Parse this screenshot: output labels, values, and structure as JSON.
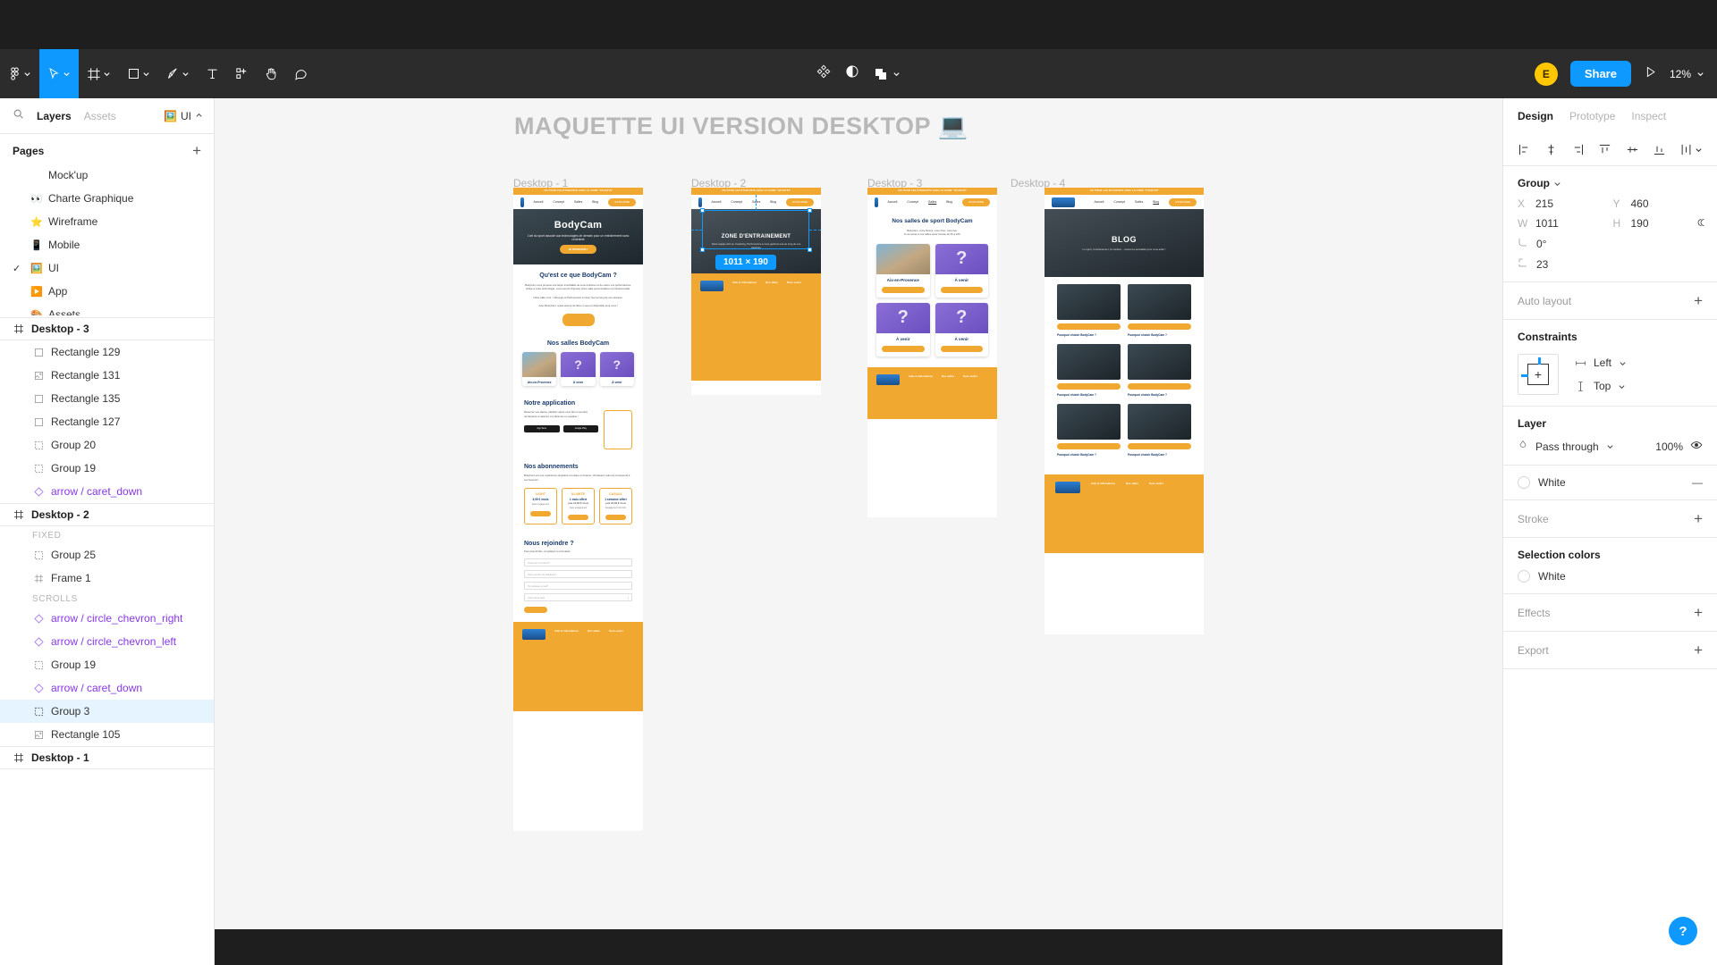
{
  "toolbar": {
    "tools": [
      {
        "name": "figma-menu-icon",
        "label": "Main menu",
        "caret": true,
        "active": false
      },
      {
        "name": "move-tool-icon",
        "label": "Move",
        "caret": true,
        "active": true
      },
      {
        "name": "frame-tool-icon",
        "label": "Frame",
        "caret": true,
        "active": false
      },
      {
        "name": "shape-tool-icon",
        "label": "Rectangle",
        "caret": true,
        "active": false
      },
      {
        "name": "pen-tool-icon",
        "label": "Pen",
        "caret": true,
        "active": false
      },
      {
        "name": "text-tool-icon",
        "label": "Text",
        "caret": false,
        "active": false
      },
      {
        "name": "components-tool-icon",
        "label": "Resources",
        "caret": false,
        "active": false
      },
      {
        "name": "hand-tool-icon",
        "label": "Hand",
        "caret": false,
        "active": false
      },
      {
        "name": "comment-tool-icon",
        "label": "Comment",
        "caret": false,
        "active": false
      }
    ],
    "center_actions": [
      {
        "name": "component-icon",
        "label": "Create component"
      },
      {
        "name": "mask-icon",
        "label": "Use as mask"
      },
      {
        "name": "boolean-icon",
        "label": "Boolean groups",
        "caret": true
      }
    ],
    "avatar_initial": "E",
    "avatar_color": "#ffc700",
    "share_label": "Share",
    "present_label": "Present",
    "zoom_level": "12%",
    "accent_color": "#0d99ff"
  },
  "left_panel": {
    "tabs": [
      {
        "label": "Layers",
        "active": true
      },
      {
        "label": "Assets",
        "active": false
      }
    ],
    "search_icon": "search-icon",
    "file_name": "UI",
    "file_emoji": "🖼️",
    "pages_title": "Pages",
    "add_page_label": "+",
    "pages": [
      {
        "label": "Mock'up",
        "emoji": "",
        "current": false
      },
      {
        "label": "Charte Graphique",
        "emoji": "👀",
        "current": false
      },
      {
        "label": "Wireframe",
        "emoji": "⭐",
        "current": false
      },
      {
        "label": "Mobile",
        "emoji": "📱",
        "current": false
      },
      {
        "label": "UI",
        "emoji": "🖼️",
        "current": true
      },
      {
        "label": "App",
        "emoji": "▶️",
        "current": false
      },
      {
        "label": "Assets",
        "emoji": "🎨",
        "current": false
      }
    ],
    "layer_groups": [
      {
        "frame": "Desktop - 3",
        "sections": [
          {
            "label": "",
            "layers": [
              {
                "label": "Rectangle 129",
                "icon": "rectangle-icon",
                "type": "shape",
                "selected": false
              },
              {
                "label": "Rectangle 131",
                "icon": "image-icon",
                "type": "image",
                "selected": false
              },
              {
                "label": "Rectangle 135",
                "icon": "rectangle-icon",
                "type": "shape",
                "selected": false
              },
              {
                "label": "Rectangle 127",
                "icon": "rectangle-icon",
                "type": "shape",
                "selected": false
              },
              {
                "label": "Group 20",
                "icon": "group-icon",
                "type": "group",
                "selected": false
              },
              {
                "label": "Group 19",
                "icon": "group-icon",
                "type": "group",
                "selected": false
              },
              {
                "label": "arrow / caret_down",
                "icon": "component-icon",
                "type": "component",
                "selected": false
              }
            ]
          }
        ]
      },
      {
        "frame": "Desktop - 2",
        "sections": [
          {
            "label": "FIXED",
            "layers": [
              {
                "label": "Group 25",
                "icon": "group-icon",
                "type": "group",
                "selected": false
              },
              {
                "label": "Frame 1",
                "icon": "frame-icon",
                "type": "frame",
                "selected": false
              }
            ]
          },
          {
            "label": "SCROLLS",
            "layers": [
              {
                "label": "arrow / circle_chevron_right",
                "icon": "component-icon",
                "type": "component",
                "selected": false
              },
              {
                "label": "arrow / circle_chevron_left",
                "icon": "component-icon",
                "type": "component",
                "selected": false
              },
              {
                "label": "Group 19",
                "icon": "group-icon",
                "type": "group",
                "selected": false
              },
              {
                "label": "arrow / caret_down",
                "icon": "component-icon",
                "type": "component",
                "selected": false
              },
              {
                "label": "Group 3",
                "icon": "group-icon",
                "type": "group",
                "selected": true
              },
              {
                "label": "Rectangle 105",
                "icon": "image-icon",
                "type": "image",
                "selected": false
              }
            ]
          }
        ]
      },
      {
        "frame": "Desktop - 1",
        "sections": []
      }
    ]
  },
  "canvas": {
    "title": "MAQUETTE UI VERSION DESKTOP 💻",
    "frames": [
      {
        "label": "Desktop - 1"
      },
      {
        "label": "Desktop - 2"
      },
      {
        "label": "Desktop - 3"
      },
      {
        "label": "Desktop - 4"
      }
    ],
    "selection_badge": "1011 × 190",
    "mock": {
      "promo_banner": "-5% POUR LES ÉTUDIANTS AVEC LE CODE \"STUDY25\"",
      "nav": [
        "Accueil",
        "Concept",
        "Salles",
        "Blog"
      ],
      "nav_cta": "S'INSCRIRE",
      "hero_title": "BodyCam",
      "hero_sub": "L'art du sport associé aux technologies de demain pour un entraînement sans contrainte",
      "hero_btn": "JE M'INSCRIS !",
      "s1_title": "Qu'est ce que BodyCam ?",
      "s1_body": "BodyCam vous propose une façon inoubliable de vous entraîner et de suivre vos performances. Grâce à notre technologie, vous pourrez disposer d'une salle personnalisée et professionnelle.",
      "s1_body2": "Notre salle c'est : L'Énergie et Performance à mixer tout au long de vos séances.",
      "s1_body3": "Avec BodyCam, repas assuré de faire un quoi et disponible pour vous !",
      "s2_title": "Nos salles BodyCam",
      "s2_sub": "BodyCam, votre fitness, votre futur, votre lieu.\nTu as accès à nos salles toute l'année de 6h à 23h.",
      "s3_title": "Nos salles de sport BodyCam",
      "s4_title": "Notre application",
      "s4_body": "Réservez vos places, planifiez après vous fait un sportive remarquent et assurez vos abonnés en quelque !",
      "store_badges": [
        "App Store",
        "Google Play"
      ],
      "s5_title": "Nos abonnements",
      "s5_body": "BodyCam est une expérience singulière et unique en France. Choisissez celui qui correspond à vos besoins !",
      "plans": [
        {
          "name": "LIGHT",
          "price": "9,99 € /mois",
          "note": "Sans engagement",
          "cta": "JE M'INSCRIS"
        },
        {
          "name": "ILLIMITÉ",
          "price": "1 mois offert",
          "price2": "puis 24,99 € /mois",
          "note": "Sans engagement",
          "cta": "JE M'INSCRIS"
        },
        {
          "name": "CASUAL",
          "price": "1 semaine offert",
          "price2": "puis 29,99 € /mois",
          "note": "Engagement 12 mois",
          "cta": "JE M'INSCRIS"
        }
      ],
      "s6_title": "Nous rejoindre ?",
      "s6_sub": "Pour plus d'infos, complétez ce formulaire",
      "form_fields": [
        "Votre nom et prénom*",
        "Votre numéro de téléphone*",
        "Ton adresse e-mail*"
      ],
      "form_select": "Choix de la suite",
      "form_cta": "ENVOYER",
      "footer_cols": [
        "Aide et informations",
        "Nos salles",
        "Nous suivre"
      ],
      "gym_cards": [
        {
          "title": "Aix-en-Provence",
          "type": "photo",
          "cta": "Voir sur la carte"
        },
        {
          "title": "À venir",
          "type": "placeholder",
          "cta": "Voir sur la carte"
        },
        {
          "title": "À venir",
          "type": "placeholder",
          "cta": "Voir sur la carte"
        },
        {
          "title": "À venir",
          "type": "placeholder",
          "cta": "Voir sur la carte"
        }
      ],
      "zone_title": "ZONE D'ENTRAINEMENT",
      "zone_sub": "Notre équipe d'ici en Coaching, Performance à vous guidons tout au long de vos séances",
      "blog_title": "BLOG",
      "blog_sub": "Le sport, l'entrainement, la nutrition... toutes les actualités pour vous aider !",
      "blog_card_title": "Pourquoi choisir BodyCam ?"
    }
  },
  "right_panel": {
    "tabs": [
      {
        "label": "Design",
        "active": true
      },
      {
        "label": "Prototype",
        "active": false
      },
      {
        "label": "Inspect",
        "active": false
      }
    ],
    "align_icons": [
      "align-left-icon",
      "align-horizontal-center-icon",
      "align-right-icon",
      "align-top-icon",
      "align-vertical-center-icon",
      "align-bottom-icon",
      "distribute-icon"
    ],
    "selection_type": "Group",
    "position": {
      "x_label": "X",
      "x_value": "215",
      "y_label": "Y",
      "y_value": "460",
      "w_label": "W",
      "w_value": "1011",
      "h_label": "H",
      "h_value": "190",
      "rotation": "0°",
      "corner_radius": "23"
    },
    "auto_layout": {
      "label": "Auto layout",
      "add": "+"
    },
    "constraints": {
      "title": "Constraints",
      "horizontal": "Left",
      "vertical": "Top"
    },
    "layer": {
      "title": "Layer",
      "blend_mode": "Pass through",
      "opacity": "100%",
      "visibility_icon": "eye-icon"
    },
    "fill": {
      "name": "White",
      "remove": "—"
    },
    "stroke": {
      "title": "Stroke",
      "add": "+"
    },
    "selection_colors": {
      "title": "Selection colors",
      "items": [
        "White"
      ]
    },
    "effects": {
      "title": "Effects",
      "add": "+"
    },
    "export": {
      "title": "Export",
      "add": "+"
    },
    "help_label": "?"
  }
}
